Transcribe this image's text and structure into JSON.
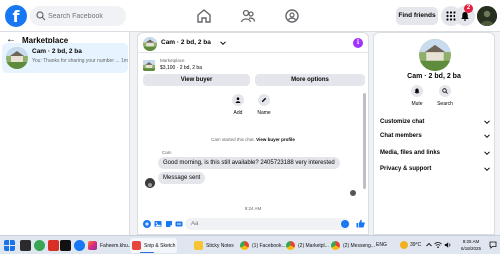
{
  "search": {
    "placeholder": "Search Facebook"
  },
  "header": {
    "find_friends_label": "Find friends",
    "notification_count": "2"
  },
  "sidebar": {
    "title": "Marketplace",
    "conversation": {
      "name": "Cam · 2 bd, 2 ba",
      "preview": "You: Thanks for sharing your number ... 1m"
    }
  },
  "chat": {
    "title": "Cam · 2 bd, 2 ba",
    "listing_label": "Marketplace",
    "listing_price": "$3,100 · 2 bd, 2 ba",
    "view_buyer_label": "View buyer",
    "more_options_label": "More options",
    "actions": [
      {
        "label": "Add"
      },
      {
        "label": "Name"
      }
    ],
    "system_note_prefix": "Cam started this chat.",
    "system_note_link": "View buyer profile",
    "sender_name": "Cam",
    "messages": [
      {
        "text": "Good morning, is this still available? 2405723188 very interested"
      },
      {
        "text": "Message sent"
      }
    ],
    "timestamp": "9:24 AM",
    "composer_placeholder": "Aa"
  },
  "right_panel": {
    "name": "Cam · 2 bd, 2 ba",
    "actions": [
      {
        "label": "Mute"
      },
      {
        "label": "Search"
      }
    ],
    "sections": [
      {
        "label": "Customize chat"
      },
      {
        "label": "Chat members"
      },
      {
        "label": "Media, files and links"
      },
      {
        "label": "Privacy & support"
      }
    ]
  },
  "taskbar": {
    "apps": [
      {
        "label": "Faheem.khu...",
        "icon": "instagram-icon"
      },
      {
        "label": "Snip & Sketch",
        "icon": "snip-icon"
      },
      {
        "label": "Sticky Notes",
        "icon": "sticky-notes-icon"
      },
      {
        "label": "(1) Facebook...",
        "icon": "chrome-icon"
      },
      {
        "label": "(2) Marketpl...",
        "icon": "chrome-icon"
      },
      {
        "label": "(2) Messeng...",
        "icon": "chrome-icon"
      }
    ],
    "language": "ENG",
    "weather": "39°C",
    "time": "9:25 AM",
    "date": "6/18/2025"
  },
  "colors": {
    "facebook_blue": "#1877f2",
    "selected_conversation": "#e7f3ff",
    "badge_red": "#e41e3f",
    "info_purple": "#a033ff"
  }
}
